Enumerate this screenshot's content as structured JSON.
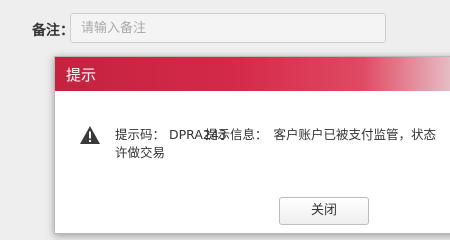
{
  "form": {
    "remark_label": "备注：",
    "remark_placeholder": "请输入备注"
  },
  "dialog": {
    "title": "提示",
    "icon": "warning-icon",
    "code_label": "提示码：",
    "code_value": "DPRA243",
    "info_label": "提示信息：",
    "info_text": "客户账户已被支付监管，状态",
    "info_text_cont": "许做交易",
    "close_label": "关闭",
    "header_color": "#c4223f"
  }
}
